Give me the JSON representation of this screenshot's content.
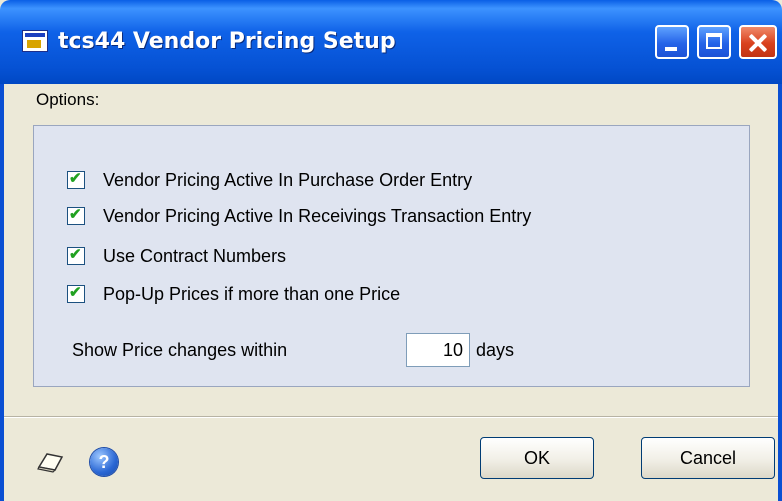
{
  "window": {
    "title": "tcs44 Vendor Pricing Setup"
  },
  "options": {
    "label": "Options:",
    "checkboxes": [
      {
        "label": "Vendor Pricing Active In Purchase Order Entry",
        "checked": true
      },
      {
        "label": "Vendor Pricing Active In Receivings Transaction Entry",
        "checked": true
      },
      {
        "label": "Use Contract Numbers",
        "checked": true
      },
      {
        "label": "Pop-Up Prices if more than one Price",
        "checked": true
      }
    ],
    "price_changes": {
      "label": "Show Price changes within",
      "value": "10",
      "unit": "days"
    }
  },
  "footer": {
    "ok_label": "OK",
    "cancel_label": "Cancel",
    "note_icon": "note-icon",
    "help_icon": "help-icon"
  },
  "colors": {
    "titlebar": "#0A5FE6",
    "group_background": "#DFE4F0",
    "dialog_background": "#ECE9D8",
    "checkmark": "#21A121"
  }
}
